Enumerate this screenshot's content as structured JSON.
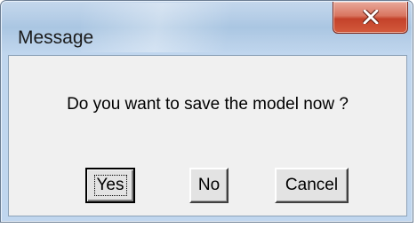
{
  "dialog": {
    "title": "Message",
    "message": "Do you want to save the model now ?",
    "buttons": {
      "yes": "Yes",
      "no": "No",
      "cancel": "Cancel"
    },
    "default_button": "yes"
  },
  "icons": {
    "close": "close-icon"
  },
  "colors": {
    "titlebar": "#b9d0e8",
    "close_button": "#c4422a",
    "client_background": "#f0f0f0"
  }
}
